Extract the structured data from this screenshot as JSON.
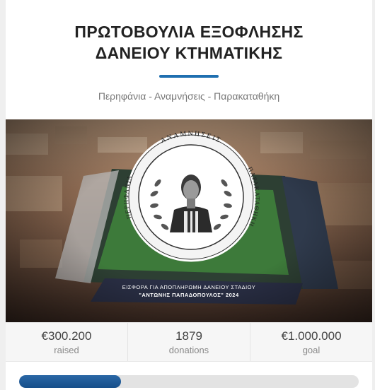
{
  "campaign": {
    "title_line1": "ΠΡΩΤΟΒΟΥΛΙΑ ΕΞΟΦΛΗΣΗΣ",
    "title_line2": "ΔΑΝΕΙΟΥ ΚΤΗΜΑΤΙΚΗΣ",
    "subtitle": "Περηφάνια - Αναμνήσεις - Παρακαταθήκη",
    "accent_color": "#1f6fb0"
  },
  "hero": {
    "emblem_ring_text": "ΠΕΡΗΦΑΝΙΑ • ΑΝΑΜΝΗΣΕΙΣ • ΠΑΡΑΚΑΤΑΘΗΚΗ •",
    "caption_line1": "ΕΙΣΦΟΡΑ ΓΙΑ ΑΠΟΠΛΗΡΩΜΗ ΔΑΝΕΙΟΥ ΣΤΑΔΙΟΥ",
    "caption_line2": "\"ΑΝΤΩΝΗΣ ΠΑΠΑΔΟΠΟΥΛΟΣ\" 2024"
  },
  "stats": {
    "raised_value": "€300.200",
    "raised_label": "raised",
    "donations_value": "1879",
    "donations_label": "donations",
    "goal_value": "€1.000.000",
    "goal_label": "goal"
  },
  "progress": {
    "fraction": 0.3
  }
}
